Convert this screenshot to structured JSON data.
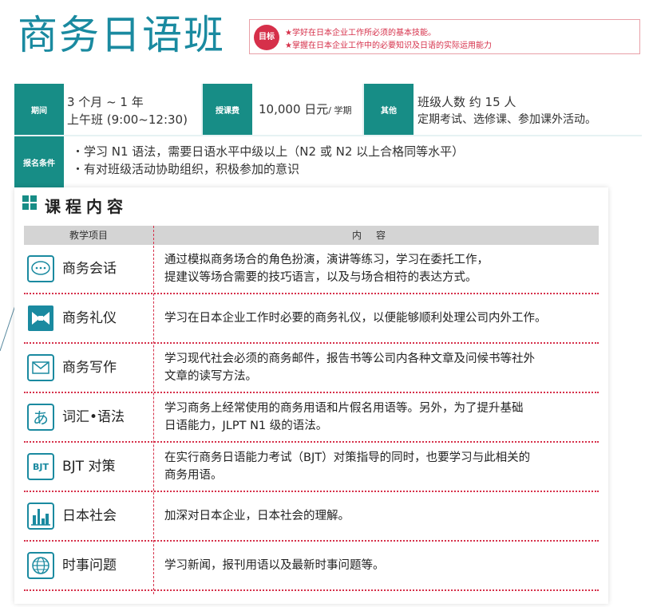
{
  "title": "商务日语班",
  "goal": {
    "badge": "目标",
    "lines": [
      "★学好在日本企业工作所必须的基本技能。",
      "★掌握在日本企业工作中的必要知识及日语的实际运用能力"
    ]
  },
  "info": {
    "period_label": "期间",
    "period_value": [
      "3 个月 ~ 1 年",
      "上午班 (9:00~12:30)"
    ],
    "fee_label": "授课费",
    "fee_value": "10,000 日元",
    "fee_unit": "/ 学期",
    "other_label": "其他",
    "other_value": [
      "班级人数 约 15 人",
      "定期考试、选修课、参加课外活动。"
    ],
    "req_label": "报名条件",
    "req_value": [
      "・学习 N1 语法，需要日语水平中级以上（N2 或 N2 以上合格同等水平）",
      "・有对班级活动协助组织，积极参加的意识"
    ]
  },
  "course": {
    "title": "课程内容",
    "col1": "教学项目",
    "col2": "内容",
    "rows": [
      {
        "icon": "speech-bubble-icon",
        "name": "商务会话",
        "desc": [
          "通过模拟商务场合的角色扮演，演讲等练习，学习在委托工作，",
          "提建议等场合需要的技巧语言，以及与场合相符的表达方式。"
        ]
      },
      {
        "icon": "bow-tie-icon",
        "name": "商务礼仪",
        "desc": [
          "学习在日本企业工作时必要的商务礼仪，以便能够顺利处理公司内外工作。"
        ]
      },
      {
        "icon": "envelope-icon",
        "name": "商务写作",
        "desc": [
          "学习现代社会必须的商务邮件，报告书等公司内各种文章及问候书等社外",
          "文章的读写方法。"
        ]
      },
      {
        "icon": "hiragana-a-icon",
        "icon_text": "あ",
        "name": "词汇•语法",
        "desc": [
          "学习商务上经常使用的商务用语和片假名用语等。另外，为了提升基础",
          "日语能力，JLPT N1 级的语法。"
        ]
      },
      {
        "icon": "bjt-icon",
        "icon_text": "BJT",
        "name": "BJT 对策",
        "desc": [
          "在实行商务日语能力考试（BJT）对策指导的同时，也要学习与此相关的",
          "商务用语。"
        ]
      },
      {
        "icon": "city-skyline-icon",
        "name": "日本社会",
        "desc": [
          "加深对日本企业，日本社会的理解。"
        ]
      },
      {
        "icon": "globe-icon",
        "name": "时事问题",
        "desc": [
          "学习新闻，报刊用语以及最新时事问题等。"
        ]
      }
    ]
  },
  "colors": {
    "teal": "#178d86",
    "title": "#1a8aa0",
    "red": "#d6304a"
  }
}
